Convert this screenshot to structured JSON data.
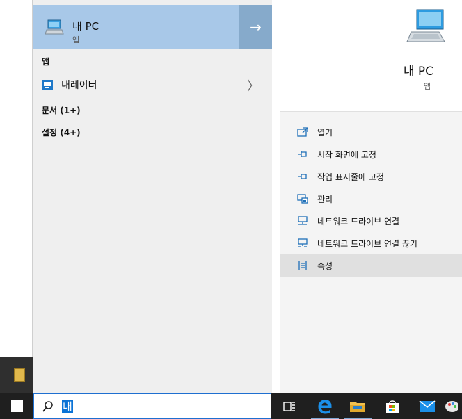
{
  "best_match": {
    "title": "내 PC",
    "subtitle": "앱",
    "open_arrow": "→",
    "icon": "computer-icon"
  },
  "sections": {
    "apps_header": "앱",
    "docs_header": "문서 (1+)",
    "settings_header": "설정 (4+)"
  },
  "apps": [
    {
      "label": "내레이터",
      "icon": "narrator-icon",
      "chevron": "〉"
    }
  ],
  "detail": {
    "title": "내 PC",
    "subtitle": "앱",
    "icon": "computer-icon"
  },
  "actions": [
    {
      "label": "열기",
      "icon": "open-icon"
    },
    {
      "label": "시작 화면에 고정",
      "icon": "pin-icon"
    },
    {
      "label": "작업 표시줄에 고정",
      "icon": "pin-icon"
    },
    {
      "label": "관리",
      "icon": "manage-icon"
    },
    {
      "label": "네트워크 드라이브 연결",
      "icon": "network-drive-icon"
    },
    {
      "label": "네트워크 드라이브 연결 끊기",
      "icon": "network-drive-disconnect-icon"
    },
    {
      "label": "속성",
      "icon": "properties-icon"
    }
  ],
  "search": {
    "query": "내"
  },
  "taskbar": {
    "icons": [
      "windows-start-icon",
      "search-icon",
      "task-view-icon",
      "edge-icon",
      "file-explorer-icon",
      "store-icon",
      "mail-icon",
      "paint-icon"
    ]
  },
  "colors": {
    "selection_blue": "#a8c8e8",
    "arrow_blue": "#86aacb",
    "taskbar": "#1f1f1f",
    "accent": "#0b73d6"
  }
}
